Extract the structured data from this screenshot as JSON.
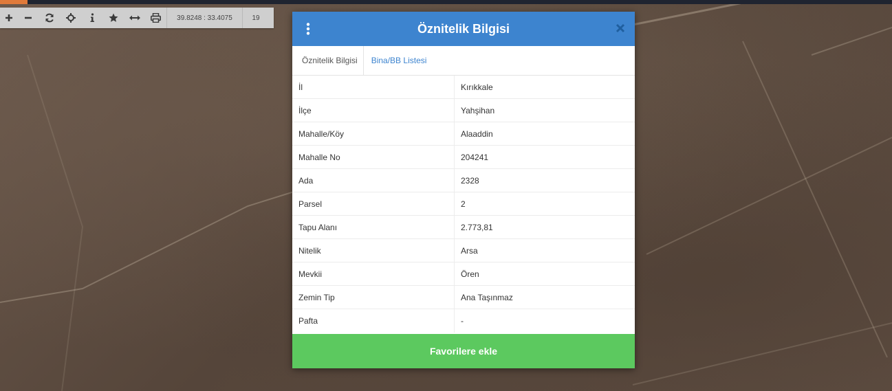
{
  "colors": {
    "header": "#3d84cf",
    "favorite_button": "#5cc95f",
    "toolbar": "#cfcfcf",
    "link": "#3d84cf"
  },
  "toolbar": {
    "tools": [
      {
        "icon": "plus-icon",
        "label": "zoom-in"
      },
      {
        "icon": "minus-icon",
        "label": "zoom-out"
      },
      {
        "icon": "refresh-icon",
        "label": "refresh"
      },
      {
        "icon": "crosshair-icon",
        "label": "locate"
      },
      {
        "icon": "info-icon",
        "label": "info"
      },
      {
        "icon": "star-icon",
        "label": "favorites"
      },
      {
        "icon": "measure-icon",
        "label": "measure"
      },
      {
        "icon": "print-icon",
        "label": "print"
      }
    ],
    "coordinates": "39.8248 : 33.4075",
    "zoom_level": "19"
  },
  "dialog": {
    "title": "Öznitelik Bilgisi",
    "tabs": [
      {
        "label": "Öznitelik Bilgisi",
        "active": true
      },
      {
        "label": "Bina/BB Listesi",
        "active": false
      }
    ],
    "rows": [
      {
        "key": "İl",
        "value": "Kırıkkale"
      },
      {
        "key": "İlçe",
        "value": "Yahşihan"
      },
      {
        "key": "Mahalle/Köy",
        "value": "Alaaddin"
      },
      {
        "key": "Mahalle No",
        "value": "204241"
      },
      {
        "key": "Ada",
        "value": "2328"
      },
      {
        "key": "Parsel",
        "value": "2"
      },
      {
        "key": "Tapu Alanı",
        "value": "2.773,81"
      },
      {
        "key": "Nitelik",
        "value": "Arsa"
      },
      {
        "key": "Mevkii",
        "value": "Ören"
      },
      {
        "key": "Zemin Tip",
        "value": "Ana Taşınmaz"
      },
      {
        "key": "Pafta",
        "value": "-"
      }
    ],
    "favorite_button_label": "Favorilere ekle"
  }
}
